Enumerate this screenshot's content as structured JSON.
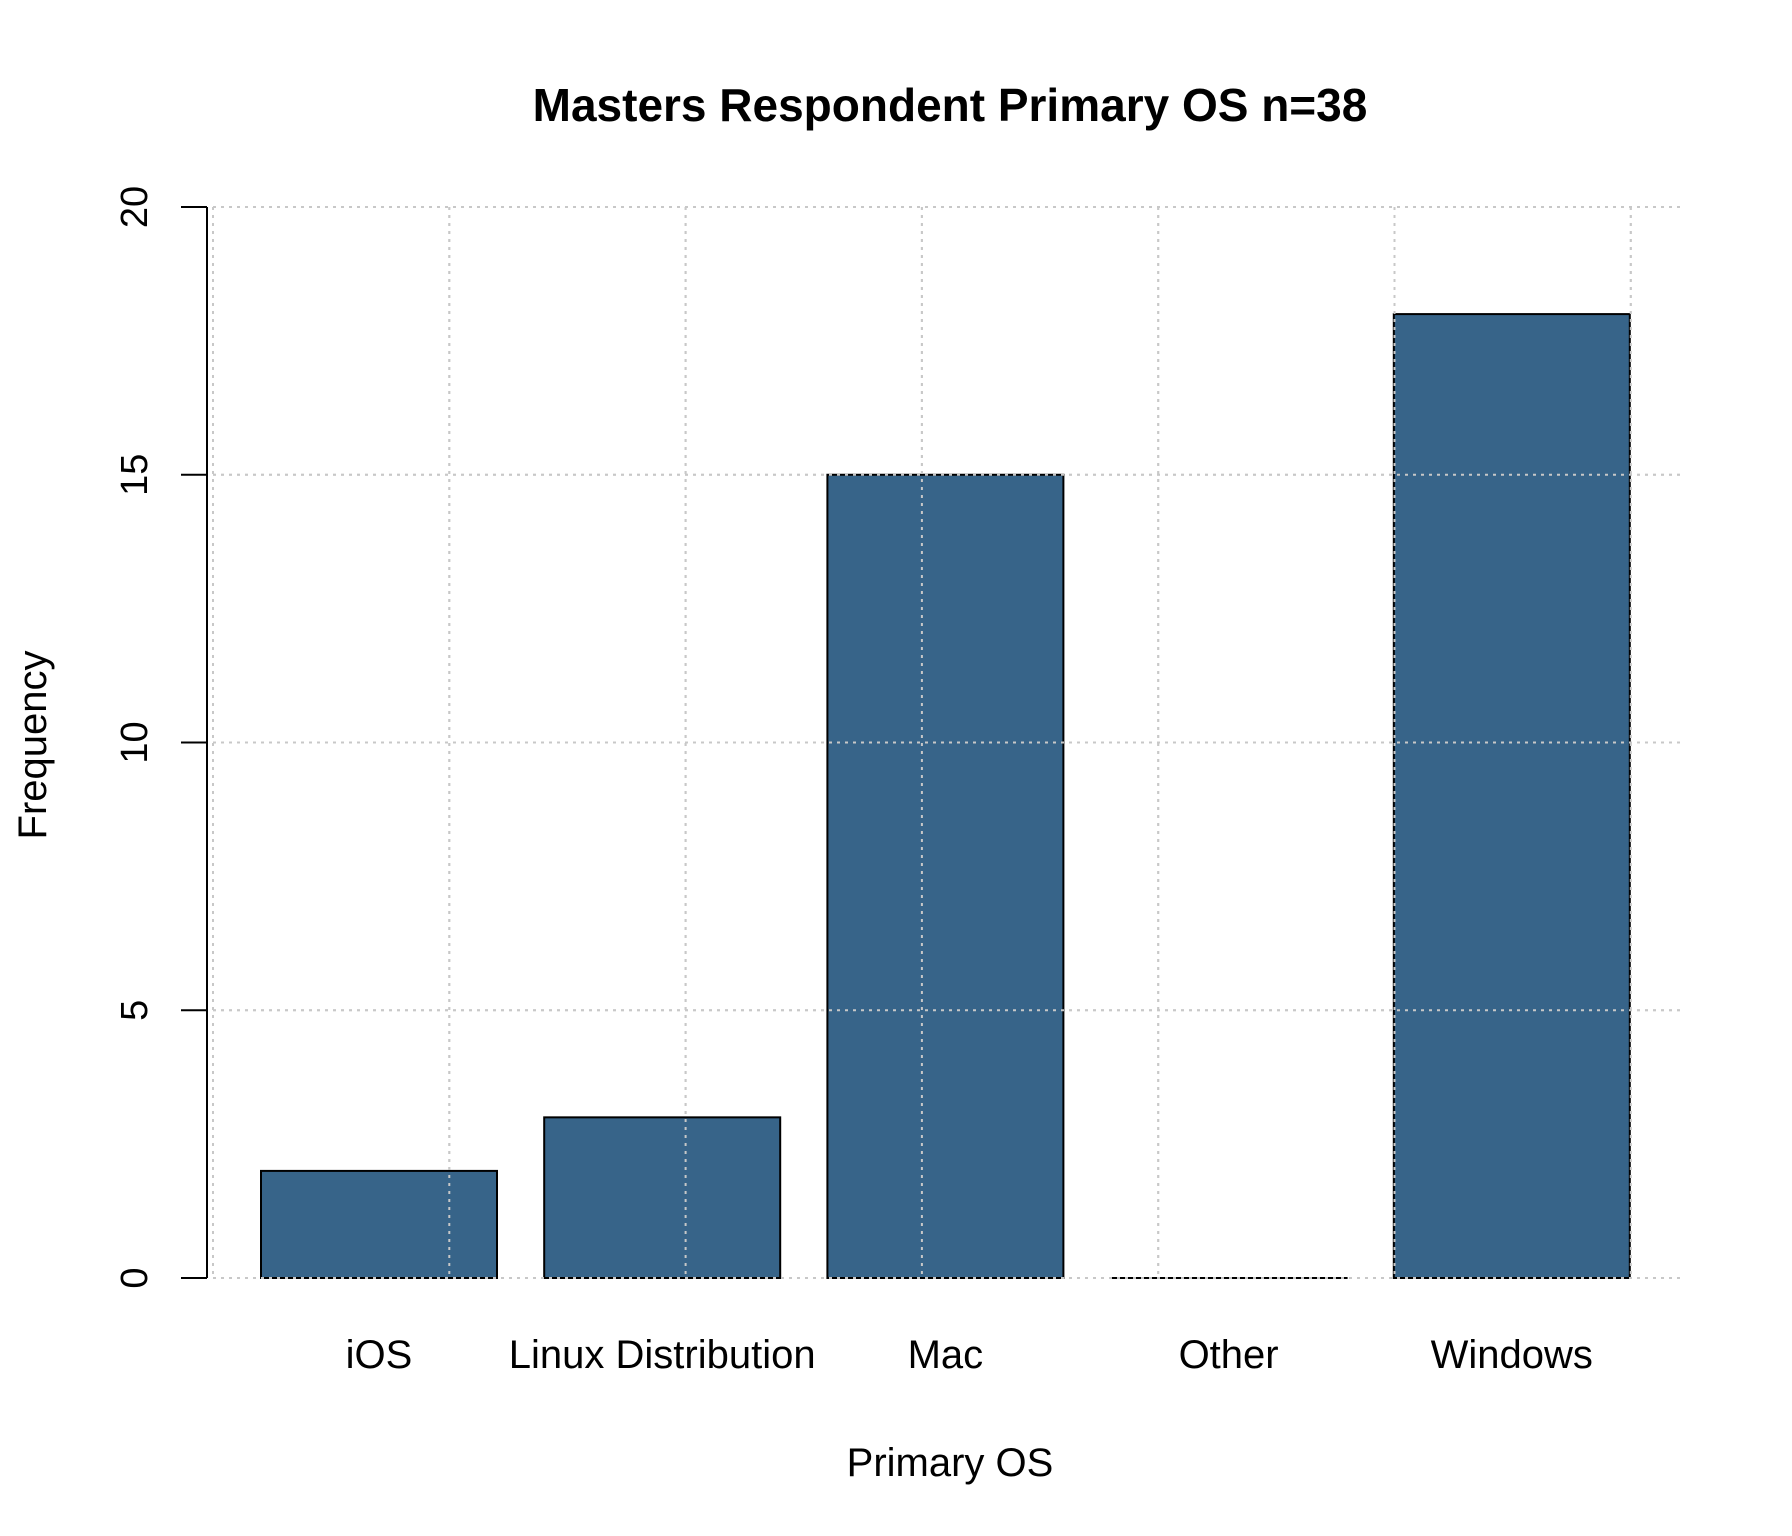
{
  "chart_data": {
    "type": "bar",
    "title": "Masters Respondent Primary OS n=38",
    "xlabel": "Primary OS",
    "ylabel": "Frequency",
    "categories": [
      "iOS",
      "Linux Distribution",
      "Mac",
      "Other",
      "Windows"
    ],
    "values": [
      2,
      3,
      15,
      0,
      18
    ],
    "ylim": [
      0,
      20
    ],
    "yticks": [
      "0",
      "5",
      "10",
      "15",
      "20"
    ],
    "grid": true,
    "bar_color": "#376489"
  }
}
